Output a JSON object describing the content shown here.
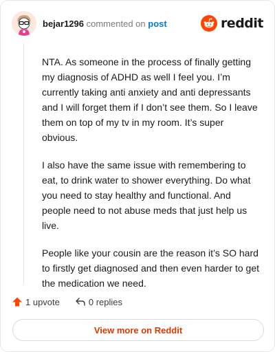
{
  "comment": {
    "username": "bejar1296",
    "action_text": "commented on",
    "post_link": "post",
    "paragraphs": [
      "NTA. As someone in the process of finally getting my diagnosis of ADHD as well I feel you. I’m currently taking anti anxiety and anti depressants and I will forget them if I don’t see them. So I leave them on top of my tv in my room. It’s super obvious.",
      "I also have the same issue with remembering to eat, to drink water to shower everything. Do what you need to stay healthy and functional. And people need to not abuse meds that just help us live.",
      "People like your cousin are the reason it’s SO hard to firstly get diagnosed and then even harder to get the medication we need."
    ]
  },
  "brand": {
    "wordmark": "reddit",
    "icon": "reddit-snoo-icon",
    "color": "#ff4500"
  },
  "actions": {
    "upvote_label": "1 upvote",
    "upvote_icon": "upvote-arrow-icon",
    "upvote_color": "#ff4500",
    "replies_label": "0 replies",
    "reply_icon": "reply-icon"
  },
  "footer": {
    "view_more_label": "View more on Reddit",
    "button_text_color": "#d93a00"
  }
}
